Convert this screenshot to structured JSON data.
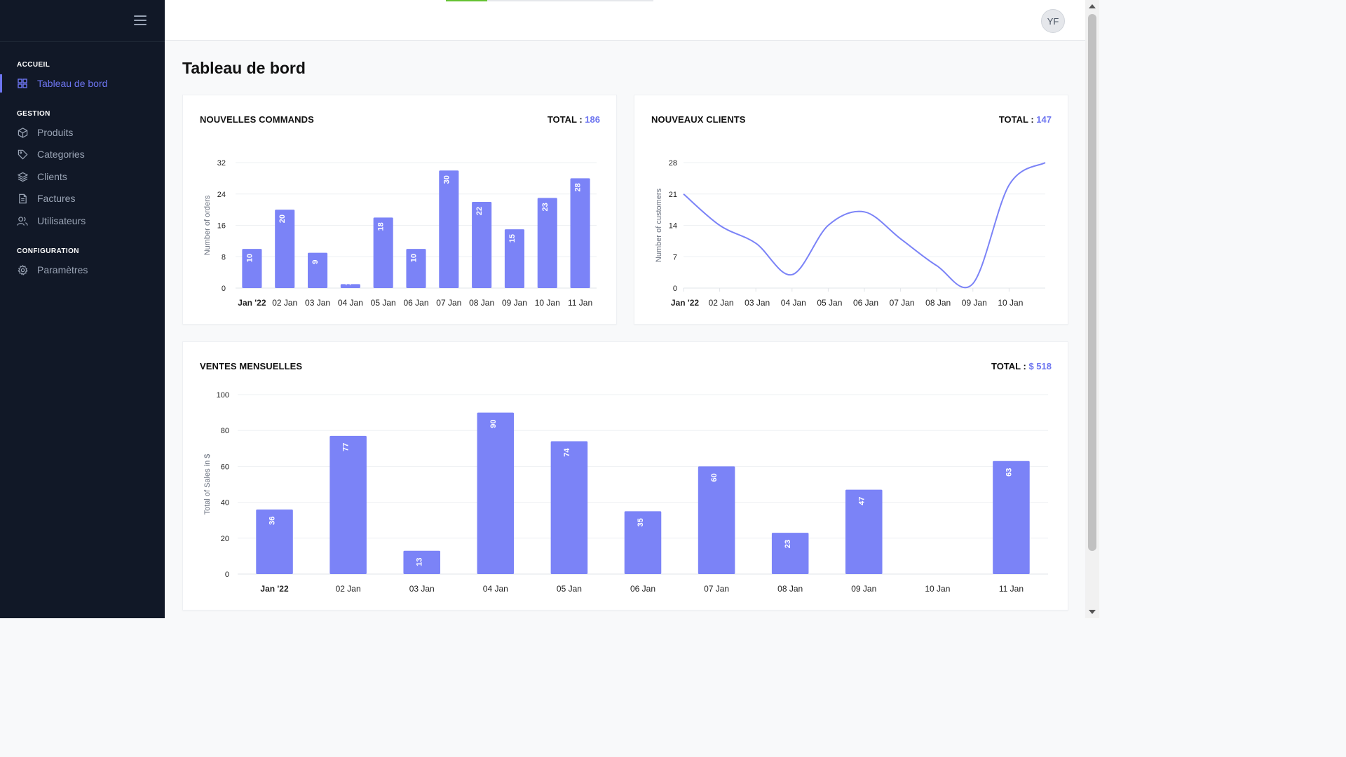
{
  "sidebar": {
    "sections": [
      {
        "label": "ACCUEIL",
        "items": [
          {
            "label": "Tableau de bord",
            "icon": "grid-icon",
            "active": true
          }
        ]
      },
      {
        "label": "GESTION",
        "items": [
          {
            "label": "Produits",
            "icon": "box-icon"
          },
          {
            "label": "Categories",
            "icon": "tag-icon"
          },
          {
            "label": "Clients",
            "icon": "layers-icon"
          },
          {
            "label": "Factures",
            "icon": "file-icon"
          },
          {
            "label": "Utilisateurs",
            "icon": "users-icon"
          }
        ]
      },
      {
        "label": "CONFIGURATION",
        "items": [
          {
            "label": "Paramètres",
            "icon": "gear-icon"
          }
        ]
      }
    ]
  },
  "header": {
    "avatar": "YF",
    "loading_progress": 0.2
  },
  "page": {
    "title": "Tableau de bord"
  },
  "cards": {
    "orders": {
      "title": "NOUVELLES COMMANDS",
      "total_label": "TOTAL :",
      "total_value": "186"
    },
    "clients": {
      "title": "NOUVEAUX CLIENTS",
      "total_label": "TOTAL :",
      "total_value": "147"
    },
    "sales": {
      "title": "VENTES MENSUELLES",
      "total_label": "TOTAL :",
      "total_value": "$ 518"
    }
  },
  "colors": {
    "accent": "#6d75f0",
    "bar": "#7b83f7",
    "sidebar_bg": "#111827",
    "progress": "#65c232"
  },
  "chart_data": [
    {
      "type": "bar",
      "ylabel": "Number of orders",
      "categories": [
        "Jan '22",
        "02 Jan",
        "03 Jan",
        "04 Jan",
        "05 Jan",
        "06 Jan",
        "07 Jan",
        "08 Jan",
        "09 Jan",
        "10 Jan",
        "11 Jan"
      ],
      "values": [
        10,
        20,
        9,
        1,
        18,
        10,
        30,
        22,
        15,
        23,
        28
      ],
      "yticks": [
        0,
        8,
        16,
        24,
        32
      ],
      "ylim": [
        0,
        32
      ],
      "grid": true
    },
    {
      "type": "line",
      "ylabel": "Number of customers",
      "categories": [
        "Jan '22",
        "02 Jan",
        "03 Jan",
        "04 Jan",
        "05 Jan",
        "06 Jan",
        "07 Jan",
        "08 Jan",
        "09 Jan",
        "10 Jan"
      ],
      "values": [
        21,
        14,
        10,
        3,
        14,
        17,
        11,
        5,
        1,
        23,
        28
      ],
      "yticks": [
        0,
        7,
        14,
        21,
        28
      ],
      "ylim": [
        0,
        28
      ],
      "grid": true
    },
    {
      "type": "bar",
      "ylabel": "Total of Sales in $",
      "categories": [
        "Jan '22",
        "02 Jan",
        "03 Jan",
        "04 Jan",
        "05 Jan",
        "06 Jan",
        "07 Jan",
        "08 Jan",
        "09 Jan",
        "10 Jan",
        "11 Jan"
      ],
      "values": [
        36,
        77,
        13,
        90,
        74,
        35,
        60,
        23,
        47,
        0,
        63
      ],
      "yticks": [
        0,
        20,
        40,
        60,
        80,
        100
      ],
      "ylim": [
        0,
        100
      ],
      "grid": true
    }
  ]
}
